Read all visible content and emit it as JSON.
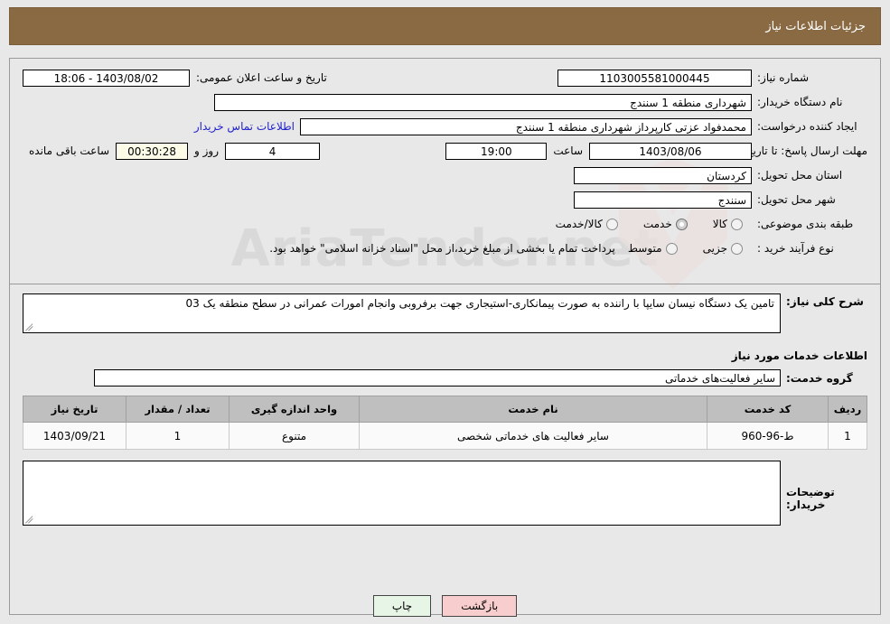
{
  "header": {
    "title": "جزئیات اطلاعات نیاز"
  },
  "form": {
    "need_number_label": "شماره نیاز:",
    "need_number_value": "1103005581000445",
    "announce_label": "تاریخ و ساعت اعلان عمومی:",
    "announce_value": "1403/08/02 - 18:06",
    "buyer_org_label": "نام دستگاه خریدار:",
    "buyer_org_value": "شهرداری منطقه 1 سنندج",
    "creator_label": "ایجاد کننده درخواست:",
    "creator_value": "محمدفواد عزتی کارپرداز شهرداری منطقه 1 سنندج",
    "contact_link": "اطلاعات تماس خریدار",
    "deadline_label": "مهلت ارسال پاسخ: تا تاریخ:",
    "deadline_date": "1403/08/06",
    "hour_label": "ساعت",
    "hour_value": "19:00",
    "days_value": "4",
    "days_and_label": "روز و",
    "timer_value": "00:30:28",
    "remaining_label": "ساعت باقی مانده",
    "province_label": "استان محل تحویل:",
    "province_value": "کردستان",
    "city_label": "شهر محل تحویل:",
    "city_value": "سنندج",
    "category_label": "طبقه بندی موضوعی:",
    "category_options": [
      {
        "label": "کالا",
        "checked": false
      },
      {
        "label": "خدمت",
        "checked": true
      },
      {
        "label": "کالا/خدمت",
        "checked": false
      }
    ],
    "purchase_type_label": "نوع فرآیند خرید :",
    "purchase_options": [
      {
        "label": "جزیی",
        "checked": false
      },
      {
        "label": "متوسط",
        "checked": false
      }
    ],
    "payment_note": "پرداخت تمام یا بخشی از مبلغ خرید،از محل \"اسناد خزانه اسلامی\" خواهد بود."
  },
  "description": {
    "label": "شرح کلی نیاز:",
    "value": "تامین یک دستگاه نیسان سایپا با راننده به صورت پیمانکاری-استیجاری جهت برفروبی وانجام امورات عمرانی در سطح منطقه یک 03"
  },
  "services": {
    "section_title": "اطلاعات خدمات مورد نیاز",
    "group_label": "گروه خدمت:",
    "group_value": "سایر فعالیت‌های خدماتی",
    "columns": [
      "ردیف",
      "کد خدمت",
      "نام خدمت",
      "واحد اندازه گیری",
      "تعداد / مقدار",
      "تاریخ نیاز"
    ],
    "rows": [
      {
        "radif": "1",
        "code": "ط-96-960",
        "name": "سایر فعالیت های خدماتی شخصی",
        "unit": "متنوع",
        "qty": "1",
        "date": "1403/09/21"
      }
    ]
  },
  "buyer_notes": {
    "label": "توضیحات خریدار:",
    "value": ""
  },
  "footer": {
    "print_label": "چاپ",
    "back_label": "بازگشت"
  },
  "watermark": {
    "text": "AriaTender.net"
  },
  "colors": {
    "header_bg": "#8a6a43",
    "link": "#2222cc",
    "timer_bg": "#fbfbe8",
    "print_btn_bg": "#e6f5e6",
    "back_btn_bg": "#f7cdcd",
    "table_header_bg": "#bfbfbf"
  }
}
